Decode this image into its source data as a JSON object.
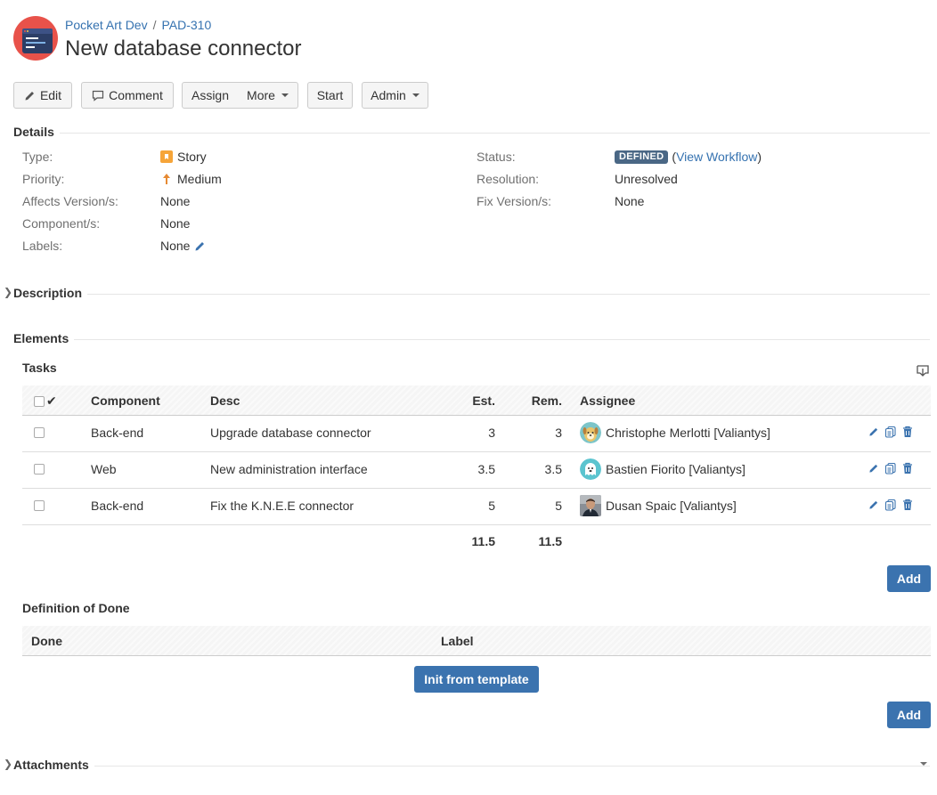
{
  "breadcrumb": {
    "project": "Pocket Art Dev",
    "separator": "/",
    "issue_key": "PAD-310"
  },
  "title": "New database connector",
  "toolbar": {
    "edit": "Edit",
    "comment": "Comment",
    "assign": "Assign",
    "more": "More",
    "start": "Start",
    "admin": "Admin"
  },
  "details": {
    "heading": "Details",
    "left": [
      {
        "label": "Type:",
        "value": "Story",
        "icon": "story-icon"
      },
      {
        "label": "Priority:",
        "value": "Medium",
        "icon": "priority-up-arrow-icon"
      },
      {
        "label": "Affects Version/s:",
        "value": "None"
      },
      {
        "label": "Component/s:",
        "value": "None"
      },
      {
        "label": "Labels:",
        "value": "None",
        "icon": "pencil-icon"
      }
    ],
    "right": [
      {
        "label": "Status:",
        "value": "DEFINED",
        "link_open": "(",
        "link": "View Workflow",
        "link_close": ")"
      },
      {
        "label": "Resolution:",
        "value": "Unresolved"
      },
      {
        "label": "Fix Version/s:",
        "value": "None"
      }
    ]
  },
  "description": {
    "heading": "Description"
  },
  "elements": {
    "heading": "Elements"
  },
  "tasks": {
    "heading": "Tasks",
    "columns": {
      "check": "✔",
      "component": "Component",
      "desc": "Desc",
      "est": "Est.",
      "rem": "Rem.",
      "assignee": "Assignee"
    },
    "rows": [
      {
        "component": "Back-end",
        "desc": "Upgrade database connector",
        "est": "3",
        "rem": "3",
        "assignee": "Christophe Merlotti [Valiantys]",
        "avatar": "dog-avatar"
      },
      {
        "component": "Web",
        "desc": "New administration interface",
        "est": "3.5",
        "rem": "3.5",
        "assignee": "Bastien Fiorito [Valiantys]",
        "avatar": "ghost-avatar"
      },
      {
        "component": "Back-end",
        "desc": "Fix the K.N.E.E connector",
        "est": "5",
        "rem": "5",
        "assignee": "Dusan Spaic [Valiantys]",
        "avatar": "photo-avatar"
      }
    ],
    "totals": {
      "est": "11.5",
      "rem": "11.5"
    },
    "add_label": "Add"
  },
  "dod": {
    "heading": "Definition of Done",
    "columns": {
      "done": "Done",
      "label": "Label"
    },
    "init_label": "Init from template",
    "add_label": "Add"
  },
  "attachments": {
    "heading": "Attachments"
  },
  "colors": {
    "link": "#3572b0",
    "primary": "#3b73af",
    "lozenge": "#4a6785",
    "logo_red": "#e8524a",
    "logo_navy": "#2c3e66"
  }
}
